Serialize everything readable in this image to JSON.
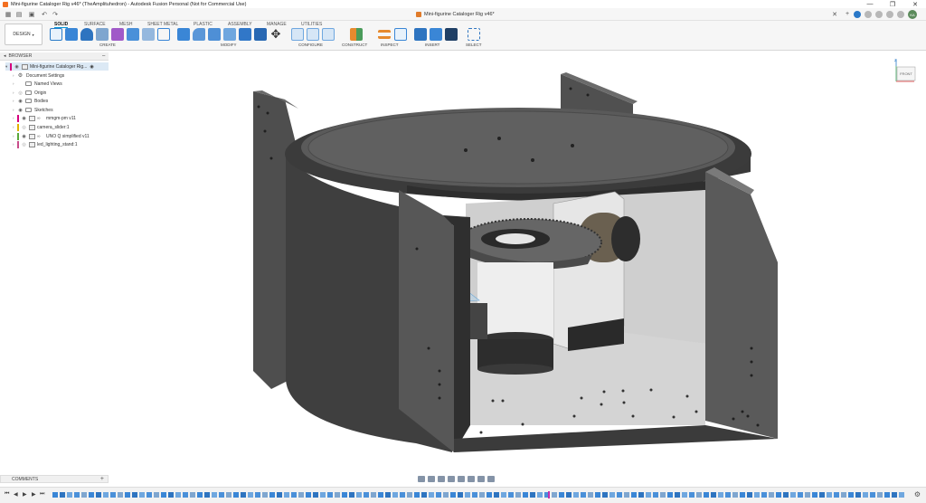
{
  "window": {
    "title": "Mini-figurine Cataloger Rig v46* (TheAmplituhedron) - Autodesk Fusion Personal (Not for Commercial Use)",
    "minimize": "—",
    "maximize": "❐",
    "close": "✕"
  },
  "document_tab": {
    "label": "Mini-figurine Cataloger Rig v46*"
  },
  "toolbar": {
    "workspace_label": "DESIGN",
    "tabs": [
      "SOLID",
      "SURFACE",
      "MESH",
      "SHEET METAL",
      "PLASTIC",
      "ASSEMBLY",
      "MANAGE",
      "UTILITIES"
    ],
    "active_tab": "SOLID",
    "groups": [
      "CREATE",
      "MODIFY",
      "CONFIGURE",
      "CONSTRUCT",
      "INSPECT",
      "INSERT",
      "SELECT"
    ]
  },
  "browser": {
    "header": "BROWSER",
    "root": "Mini-figurine Cataloger Rig...",
    "items": [
      "Document Settings",
      "Named Views",
      "Origin",
      "Bodies",
      "Sketches",
      "mmgm-pm v11",
      "camera_slider:1",
      "UNO Q simplified v11",
      "led_lighting_stand:1"
    ]
  },
  "viewcube": {
    "face": "FRONT",
    "axis": "Z"
  },
  "comments": {
    "label": "COMMENTS",
    "add": "+"
  },
  "user": {
    "initials": "KA"
  },
  "colors": {
    "accent": "#0696d7",
    "model_body": "#4a4a4a",
    "model_dark": "#2e2e2e",
    "model_light": "#d9d9d9",
    "timeline_active": "#c52fae"
  }
}
